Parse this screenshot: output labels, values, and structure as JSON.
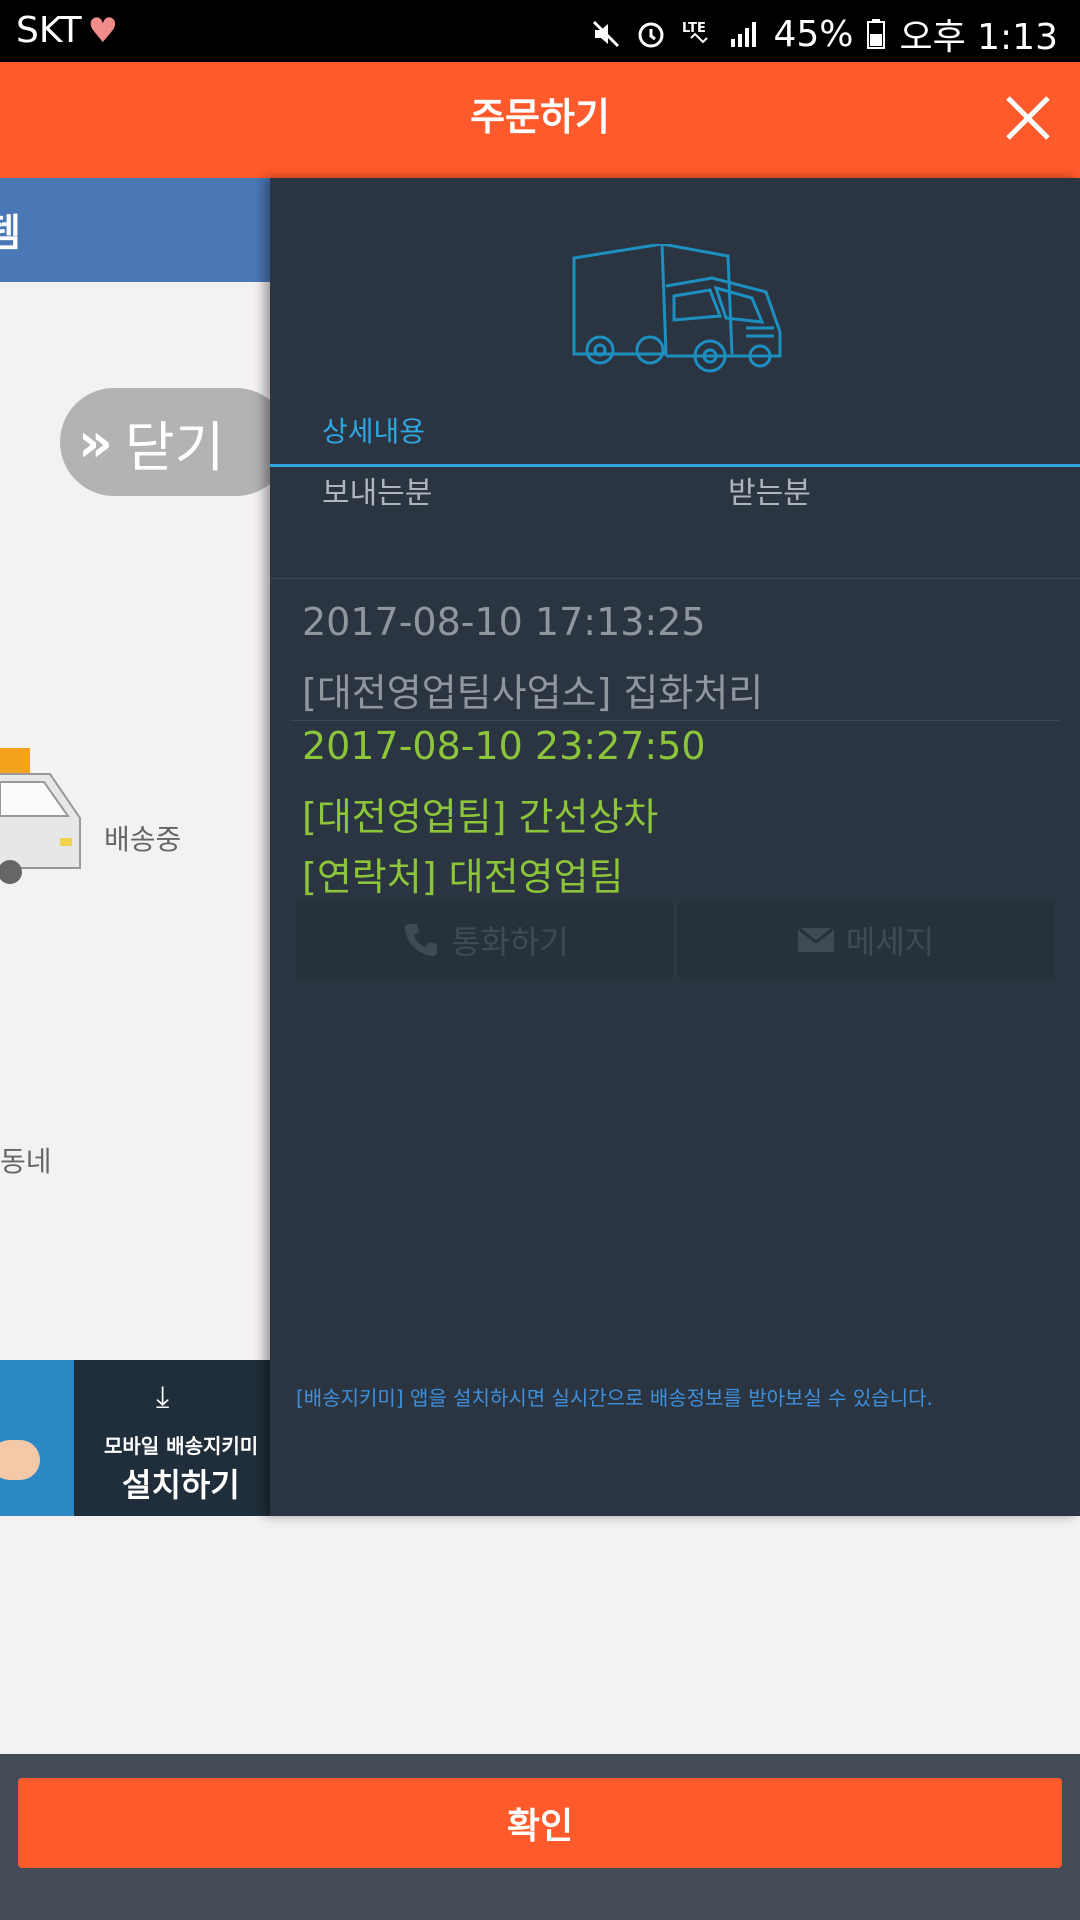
{
  "status_bar": {
    "carrier": "SKT",
    "battery": "45%",
    "time": "오후 1:13",
    "icons": [
      "heart-icon",
      "mute-icon",
      "alarm-icon",
      "lte-icon",
      "signal-icon",
      "battery-icon"
    ]
  },
  "header": {
    "title": "주문하기"
  },
  "left_panel": {
    "edge_text": "템",
    "close_label": "닫기",
    "status_delivering": "배송중",
    "dongne": "동네",
    "banner_line1": "모바일 배송지키미",
    "banner_line2": "설치하기"
  },
  "detail": {
    "tab_label": "상세내용",
    "sender_label": "보내는분",
    "receiver_label": "받는분",
    "events": [
      {
        "time": "2017-08-10 17:13:25",
        "desc": "[대전영업팀사업소] 집화처리"
      },
      {
        "time": "2017-08-10 23:27:50",
        "desc": "[대전영업팀] 간선상차",
        "contact": "[연락처] 대전영업팀"
      }
    ],
    "call_label": "통화하기",
    "message_label": "메세지",
    "notice": "[배송지키미] 앱을 설치하시면 실시간으로 배송정보를 받아보실 수 있습니다."
  },
  "bottom": {
    "confirm_label": "확인"
  },
  "colors": {
    "accent": "#ff5a2b",
    "panel_bg": "#2a3541",
    "link_blue": "#2fa6e0",
    "latest_event_green": "#8cc43a"
  }
}
